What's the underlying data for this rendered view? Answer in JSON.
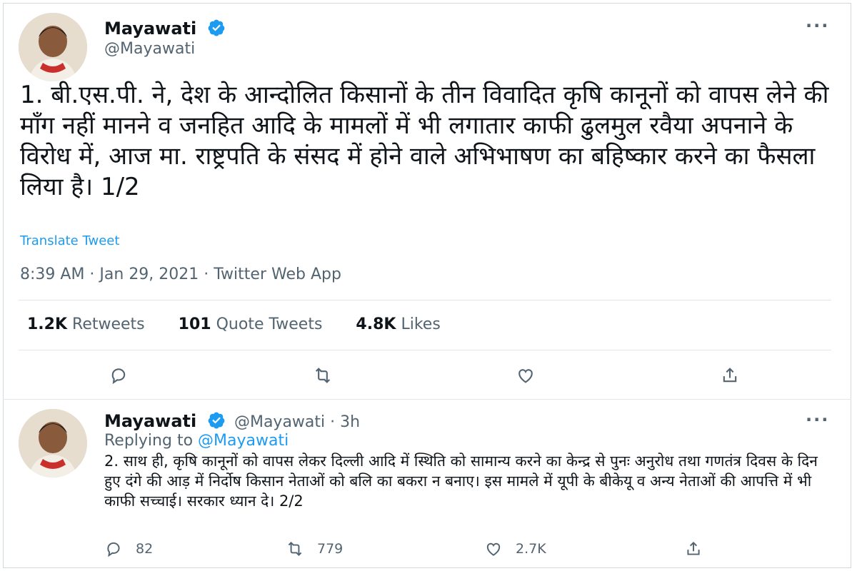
{
  "tweet": {
    "author_name": "Mayawati",
    "author_handle": "@Mayawati",
    "more_icon": "more-dots-icon",
    "text": "1. बी.एस.पी. ने, देश के आन्दोलित किसानों के तीन विवादित कृषि कानूनों को वापस लेने की माँग नहीं मानने व जनहित आदि के मामलों में भी लगातार काफी ढुलमुल रवैया अपनाने के विरोध में, आज मा. राष्ट्रपति के संसद में होने वाले अभिभाषण का बहिष्कार करने का फैसला लिया है। 1/2",
    "translate_label": "Translate Tweet",
    "meta": "8:39 AM · Jan 29, 2021 · Twitter Web App",
    "stats": {
      "retweets_count": "1.2K",
      "retweets_label": "Retweets",
      "quotes_count": "101",
      "quotes_label": "Quote Tweets",
      "likes_count": "4.8K",
      "likes_label": "Likes"
    }
  },
  "reply": {
    "author_name": "Mayawati",
    "author_handle": "@Mayawati",
    "time": "· 3h",
    "replying_prefix": "Replying to",
    "replying_handle": "@Mayawati",
    "text": "2. साथ ही, कृषि कानूनों को वापस लेकर दिल्ली आदि में स्थिति को सामान्य करने का केन्द्र से पुनः अनुरोध तथा गणतंत्र दिवस के दिन हुए दंगे की आड़ में निर्दोष किसान नेताओं को बलि का बकरा न बनाए। इस मामले में यूपी के बीकेयू व अन्य नेताओं की आपत्ति में भी काफी सच्चाई। सरकार ध्यान दे। 2/2",
    "reply_count": "82",
    "retweet_count": "779",
    "like_count": "2.7K"
  },
  "colors": {
    "accent": "#1d9bf0",
    "secondary_text": "#536471",
    "primary_text": "#0f1419"
  }
}
